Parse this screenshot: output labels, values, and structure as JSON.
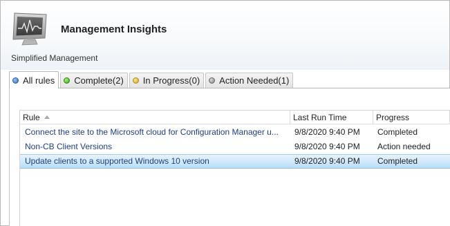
{
  "header": {
    "title": "Management Insights",
    "subtitle": "Simplified Management",
    "icon": "monitor-heartbeat-icon"
  },
  "tabs": [
    {
      "label": "All rules",
      "status_color": "#2a6bc0",
      "active": true
    },
    {
      "label": "Complete(2)",
      "status_color": "#2da01a",
      "active": false
    },
    {
      "label": "In Progress(0)",
      "status_color": "#c9a21c",
      "active": false
    },
    {
      "label": "Action Needed(1)",
      "status_color": "#7a7a7a",
      "active": false
    }
  ],
  "grid": {
    "columns": [
      "Rule",
      "Last Run Time",
      "Progress"
    ],
    "sort_column": "Rule",
    "sort_direction": "ascending",
    "rows": [
      {
        "rule": "Connect the site to the Microsoft cloud for Configuration Manager u...",
        "last_run": "9/8/2020 9:40 PM",
        "progress": "Completed",
        "selected": false
      },
      {
        "rule": "Non-CB Client Versions",
        "last_run": "9/8/2020 9:40 PM",
        "progress": "Action needed",
        "selected": false
      },
      {
        "rule": "Update clients to a supported Windows 10 version",
        "last_run": "9/8/2020 9:40 PM",
        "progress": "Completed",
        "selected": true
      }
    ]
  },
  "colors": {
    "selection": "#cfe8fb",
    "link_text": "#1c3f82"
  }
}
